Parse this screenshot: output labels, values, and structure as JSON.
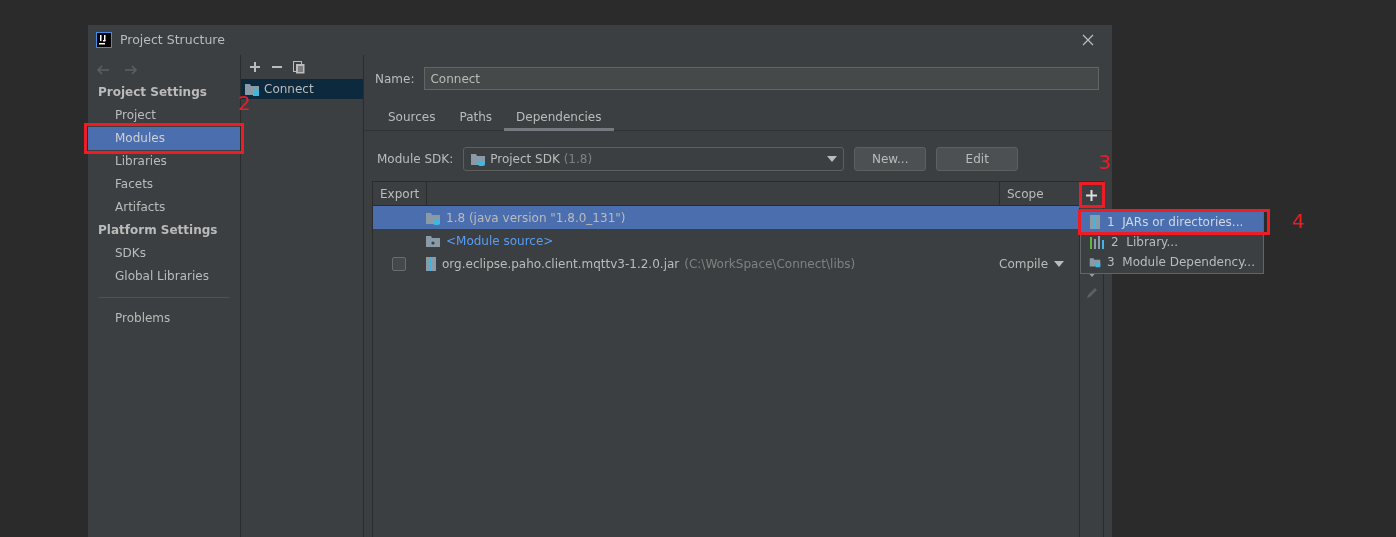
{
  "window": {
    "title": "Project Structure"
  },
  "sidebar": {
    "sections": [
      {
        "heading": "Project Settings",
        "items": [
          {
            "label": "Project",
            "selected": false
          },
          {
            "label": "Modules",
            "selected": true,
            "annotation": "2"
          },
          {
            "label": "Libraries",
            "selected": false
          },
          {
            "label": "Facets",
            "selected": false
          },
          {
            "label": "Artifacts",
            "selected": false
          }
        ]
      },
      {
        "heading": "Platform Settings",
        "items": [
          {
            "label": "SDKs",
            "selected": false
          },
          {
            "label": "Global Libraries",
            "selected": false
          }
        ]
      }
    ],
    "footer_items": [
      {
        "label": "Problems",
        "selected": false
      }
    ]
  },
  "modules": {
    "items": [
      {
        "label": "Connect",
        "selected": true
      }
    ]
  },
  "name_field": {
    "label": "Name:",
    "value": "Connect"
  },
  "tabs": [
    {
      "label": "Sources",
      "selected": false
    },
    {
      "label": "Paths",
      "selected": false
    },
    {
      "label": "Dependencies",
      "selected": true
    }
  ],
  "module_sdk": {
    "label": "Module SDK:",
    "value": "Project SDK",
    "detail": "(1.8)",
    "buttons": [
      "New...",
      "Edit"
    ]
  },
  "table": {
    "columns": [
      "Export",
      "Scope"
    ],
    "add_button": {
      "annotation": "3"
    },
    "rows": [
      {
        "kind": "sdk",
        "name": "1.8 (java version \"1.8.0_131\")",
        "selected": true
      },
      {
        "kind": "source",
        "name": "<Module source>",
        "selected": false
      },
      {
        "kind": "jar",
        "name": "org.eclipse.paho.client.mqttv3-1.2.0.jar",
        "path": "(C:\\WorkSpace\\Connect\\libs)",
        "scope": "Compile",
        "exported": false,
        "selected": false
      }
    ]
  },
  "add_menu": {
    "items": [
      {
        "kind": "jar",
        "number": "1",
        "label": "JARs or directories...",
        "selected": true,
        "annotation": "4"
      },
      {
        "kind": "library",
        "number": "2",
        "label": "Library...",
        "selected": false
      },
      {
        "kind": "module",
        "number": "3",
        "label": "Module Dependency...",
        "selected": false
      }
    ]
  }
}
